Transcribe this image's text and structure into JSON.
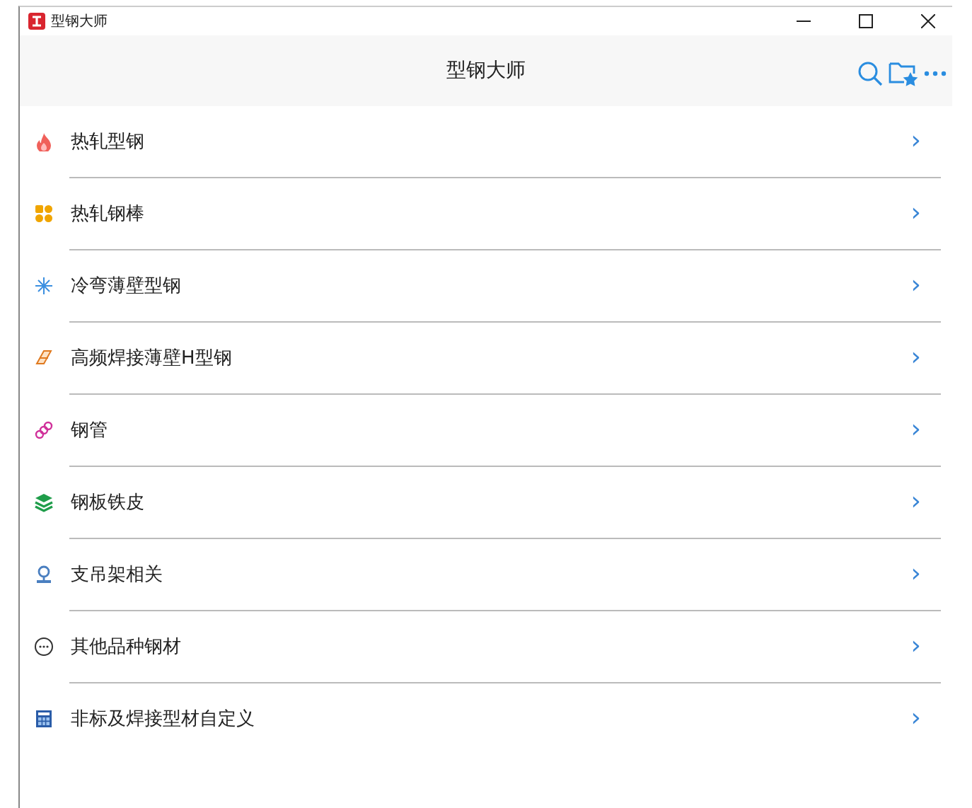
{
  "window": {
    "title": "型钢大师"
  },
  "header": {
    "title": "型钢大师"
  },
  "menu": [
    {
      "label": "热轧型钢",
      "arrow": "›"
    },
    {
      "label": "热轧钢棒",
      "arrow": "›"
    },
    {
      "label": "冷弯薄壁型钢",
      "arrow": "›"
    },
    {
      "label": "高频焊接薄壁H型钢",
      "arrow": "›"
    },
    {
      "label": "钢管",
      "arrow": "›"
    },
    {
      "label": "钢板铁皮",
      "arrow": "›"
    },
    {
      "label": "支吊架相关",
      "arrow": "›"
    },
    {
      "label": "其他品种钢材",
      "arrow": "›"
    },
    {
      "label": "非标及焊接型材自定义",
      "arrow": "›"
    }
  ]
}
